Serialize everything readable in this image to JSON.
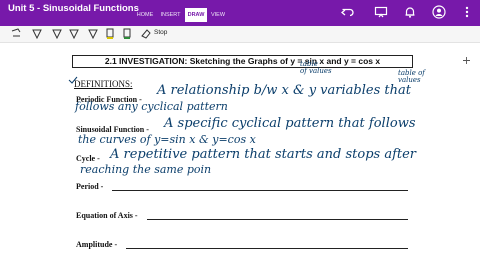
{
  "window": {
    "title": "Unit 5 - Sinusoidal Functions"
  },
  "ribbon": {
    "tabs": [
      "HOME",
      "INSERT",
      "DRAW",
      "VIEW"
    ],
    "active_tab": "DRAW"
  },
  "toolbar": {
    "stop_label": "Stop"
  },
  "document": {
    "title": "2.1 INVESTIGATION:  Sketching the Graphs of y = sin x and y = cos x",
    "definitions_heading": "DEFINITIONS:",
    "terms": [
      {
        "label": "Periodic Function -",
        "handwriting": [
          "A relationship b/w  x  &  y  variables that",
          "follows  any  cyclical  pattern"
        ]
      },
      {
        "label": "Sinusoidal Function -",
        "handwriting": [
          "A specific cyclical pattern that follows",
          "the curves  of  y=sin x  &  y=cos x"
        ]
      },
      {
        "label": "Cycle -",
        "handwriting": [
          "A repetitive pattern that starts and stops after",
          "reaching  the same poin"
        ]
      },
      {
        "label": "Period -",
        "handwriting": []
      },
      {
        "label": "Equation of Axis -",
        "handwriting": []
      },
      {
        "label": "Amplitude -",
        "handwriting": []
      }
    ],
    "annotations": {
      "table_of_values_1": [
        "table",
        "of values"
      ],
      "table_of_values_2": [
        "table of",
        "values"
      ]
    }
  },
  "colors": {
    "accent": "#7719aa",
    "ink": "#0b3e6b",
    "toolbar_bg": "#f6f6f6"
  },
  "icons": [
    "back-icon",
    "undo-icon",
    "present-icon",
    "bell-icon",
    "avatar-icon",
    "more-icon",
    "lasso-icon",
    "pen-icon",
    "highlighter-icon",
    "eraser-icon",
    "pin-icon"
  ]
}
